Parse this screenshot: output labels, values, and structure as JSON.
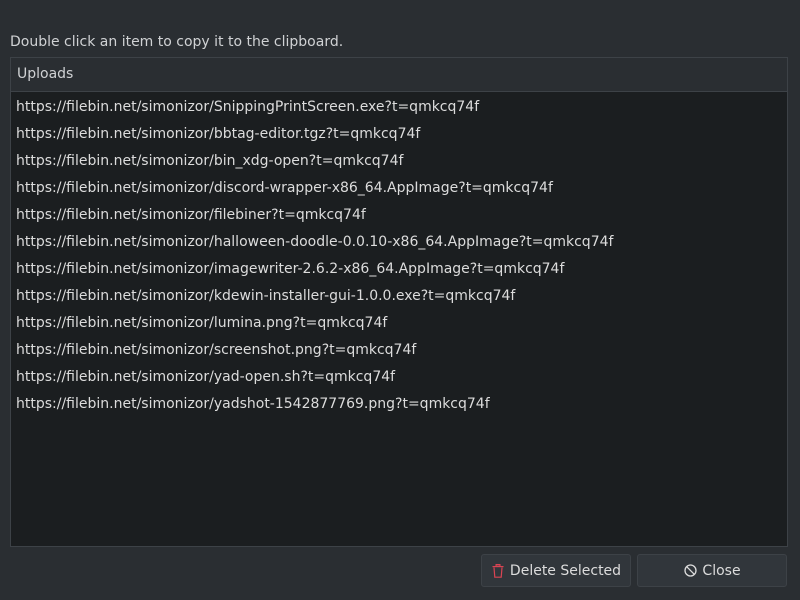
{
  "instruction": "Double click an item to copy it to the clipboard.",
  "list": {
    "header": "Uploads",
    "items": [
      "https://filebin.net/simonizor/SnippingPrintScreen.exe?t=qmkcq74f",
      "https://filebin.net/simonizor/bbtag-editor.tgz?t=qmkcq74f",
      "https://filebin.net/simonizor/bin_xdg-open?t=qmkcq74f",
      "https://filebin.net/simonizor/discord-wrapper-x86_64.AppImage?t=qmkcq74f",
      "https://filebin.net/simonizor/filebiner?t=qmkcq74f",
      "https://filebin.net/simonizor/halloween-doodle-0.0.10-x86_64.AppImage?t=qmkcq74f",
      "https://filebin.net/simonizor/imagewriter-2.6.2-x86_64.AppImage?t=qmkcq74f",
      "https://filebin.net/simonizor/kdewin-installer-gui-1.0.0.exe?t=qmkcq74f",
      "https://filebin.net/simonizor/lumina.png?t=qmkcq74f",
      "https://filebin.net/simonizor/screenshot.png?t=qmkcq74f",
      "https://filebin.net/simonizor/yad-open.sh?t=qmkcq74f",
      "https://filebin.net/simonizor/yadshot-1542877769.png?t=qmkcq74f"
    ]
  },
  "buttons": {
    "delete_label": "Delete Selected",
    "delete_icon": "trash-icon",
    "delete_icon_color": "#da4453",
    "close_label": "Close",
    "close_icon": "cancel-icon"
  }
}
